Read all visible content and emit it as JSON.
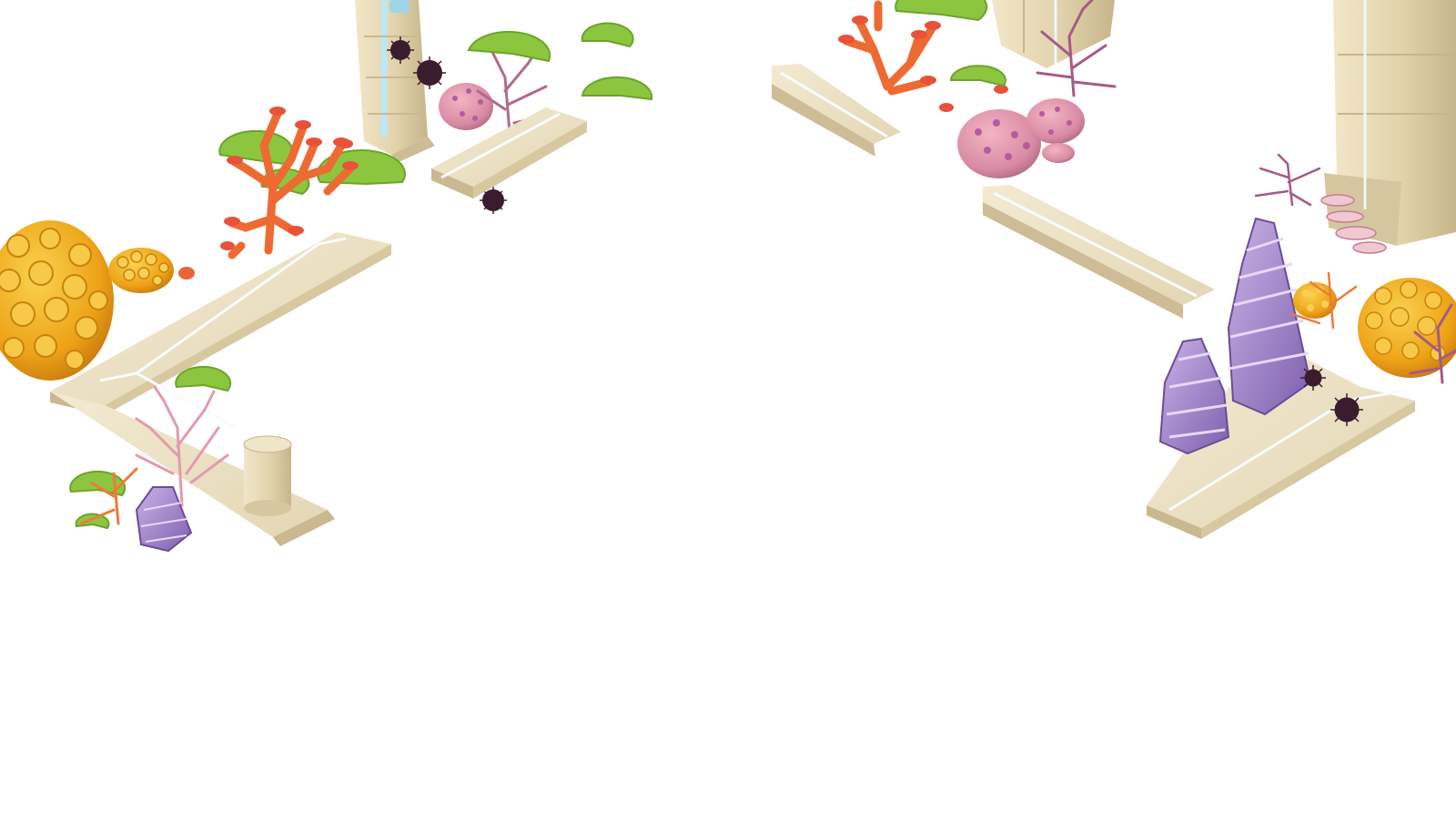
{
  "scene": {
    "kind": "isometric underwater ruins game asset sheet",
    "background": "#ffffff"
  },
  "palette": {
    "stone_light": "#ede3c8",
    "stone_mid": "#d9cba6",
    "stone_dark": "#b9a985",
    "stone_glow": "#f7fbff",
    "pillar_glow": "#8fd8e8",
    "lily_green": "#8cc63f",
    "lily_green_dark": "#6ea22c",
    "coral_orange": "#f06a32",
    "coral_orange_tip": "#e8523a",
    "coral_pink": "#d47a92",
    "coral_pink_light": "#e9a7b7",
    "coral_mauve": "#a65a86",
    "brain_yellow": "#f2a81a",
    "brain_yellow_light": "#f7c948",
    "brain_pink": "#e08aa0",
    "brain_pink_spot": "#b65ba0",
    "sponge_purple": "#a98ad0",
    "sponge_purple_dark": "#7a5ea8",
    "urchin": "#3a1c2e"
  }
}
